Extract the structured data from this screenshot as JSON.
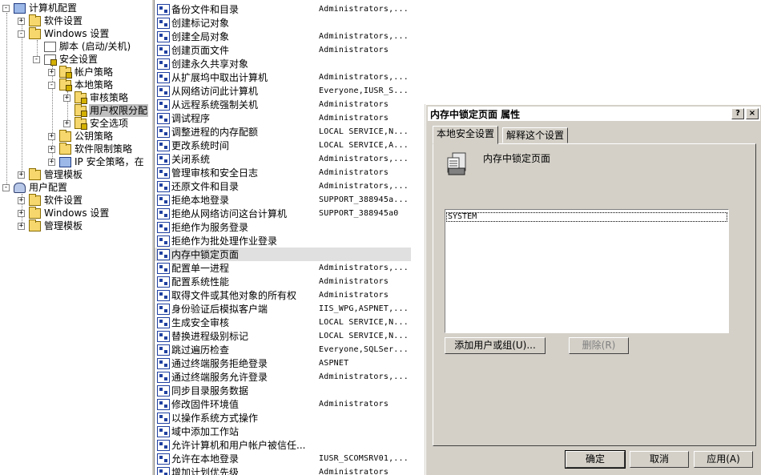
{
  "tree": {
    "items": [
      {
        "label": "计算机配置",
        "exp": "-",
        "icon": "computer-icon"
      },
      {
        "label": "软件设置",
        "exp": "+",
        "icon": "folder-icon"
      },
      {
        "label": "Windows 设置",
        "exp": "-",
        "icon": "folder-icon"
      },
      {
        "label": "脚本 (启动/关机)",
        "exp": "",
        "icon": "script-icon"
      },
      {
        "label": "安全设置",
        "exp": "-",
        "icon": "security-settings-icon"
      },
      {
        "label": "帐户策略",
        "exp": "+",
        "icon": "folder-lock-icon"
      },
      {
        "label": "本地策略",
        "exp": "-",
        "icon": "folder-lock-icon"
      },
      {
        "label": "审核策略",
        "exp": "+",
        "icon": "folder-lock-icon"
      },
      {
        "label": "用户权限分配",
        "exp": "",
        "icon": "folder-lock-icon"
      },
      {
        "label": "安全选项",
        "exp": "+",
        "icon": "folder-lock-icon"
      },
      {
        "label": "公钥策略",
        "exp": "+",
        "icon": "folder-icon"
      },
      {
        "label": "软件限制策略",
        "exp": "+",
        "icon": "folder-icon"
      },
      {
        "label": "IP 安全策略，在",
        "exp": "+",
        "icon": "ip-security-icon"
      },
      {
        "label": "管理模板",
        "exp": "+",
        "icon": "folder-icon"
      },
      {
        "label": "用户配置",
        "exp": "-",
        "icon": "user-icon"
      },
      {
        "label": "软件设置",
        "exp": "+",
        "icon": "folder-icon"
      },
      {
        "label": "Windows 设置",
        "exp": "+",
        "icon": "folder-icon"
      },
      {
        "label": "管理模板",
        "exp": "+",
        "icon": "folder-icon"
      }
    ]
  },
  "policies": [
    {
      "name": "备份文件和目录",
      "setting": "Administrators,..."
    },
    {
      "name": "创建标记对象",
      "setting": ""
    },
    {
      "name": "创建全局对象",
      "setting": "Administrators,..."
    },
    {
      "name": "创建页面文件",
      "setting": "Administrators"
    },
    {
      "name": "创建永久共享对象",
      "setting": ""
    },
    {
      "name": "从扩展坞中取出计算机",
      "setting": "Administrators,..."
    },
    {
      "name": "从网络访问此计算机",
      "setting": "Everyone,IUSR_S..."
    },
    {
      "name": "从远程系统强制关机",
      "setting": "Administrators"
    },
    {
      "name": "调试程序",
      "setting": "Administrators"
    },
    {
      "name": "调整进程的内存配额",
      "setting": "LOCAL SERVICE,N..."
    },
    {
      "name": "更改系统时间",
      "setting": "LOCAL SERVICE,A..."
    },
    {
      "name": "关闭系统",
      "setting": "Administrators,..."
    },
    {
      "name": "管理审核和安全日志",
      "setting": "Administrators"
    },
    {
      "name": "还原文件和目录",
      "setting": "Administrators,..."
    },
    {
      "name": "拒绝本地登录",
      "setting": "SUPPORT_388945a..."
    },
    {
      "name": "拒绝从网络访问这台计算机",
      "setting": "SUPPORT_388945a0"
    },
    {
      "name": "拒绝作为服务登录",
      "setting": ""
    },
    {
      "name": "拒绝作为批处理作业登录",
      "setting": ""
    },
    {
      "name": "内存中锁定页面",
      "setting": ""
    },
    {
      "name": "配置单一进程",
      "setting": "Administrators,..."
    },
    {
      "name": "配置系统性能",
      "setting": "Administrators"
    },
    {
      "name": "取得文件或其他对象的所有权",
      "setting": "Administrators"
    },
    {
      "name": "身份验证后模拟客户端",
      "setting": "IIS_WPG,ASPNET,..."
    },
    {
      "name": "生成安全审核",
      "setting": "LOCAL SERVICE,N..."
    },
    {
      "name": "替换进程级别标记",
      "setting": "LOCAL SERVICE,N..."
    },
    {
      "name": "跳过遍历检查",
      "setting": "Everyone,SQLSer..."
    },
    {
      "name": "通过终端服务拒绝登录",
      "setting": "ASPNET"
    },
    {
      "name": "通过终端服务允许登录",
      "setting": "Administrators,..."
    },
    {
      "name": "同步目录服务数据",
      "setting": ""
    },
    {
      "name": "修改固件环境值",
      "setting": "Administrators"
    },
    {
      "name": "以操作系统方式操作",
      "setting": ""
    },
    {
      "name": "域中添加工作站",
      "setting": ""
    },
    {
      "name": "允许计算机和用户帐户被信任...",
      "setting": ""
    },
    {
      "name": "允许在本地登录",
      "setting": "IUSR_SCOMSRV01,..."
    },
    {
      "name": "增加计划优先级",
      "setting": "Administrators"
    }
  ],
  "dialog": {
    "title": "内存中锁定页面 属性",
    "help_btn": "?",
    "close_btn": "×",
    "tabs": [
      "本地安全设置",
      "解释这个设置"
    ],
    "policy_title": "内存中锁定页面",
    "users": [
      "SYSTEM"
    ],
    "add_btn": "添加用户或组(U)...",
    "remove_btn": "删除(R)",
    "ok_btn": "确定",
    "cancel_btn": "取消",
    "apply_btn": "应用(A)"
  }
}
